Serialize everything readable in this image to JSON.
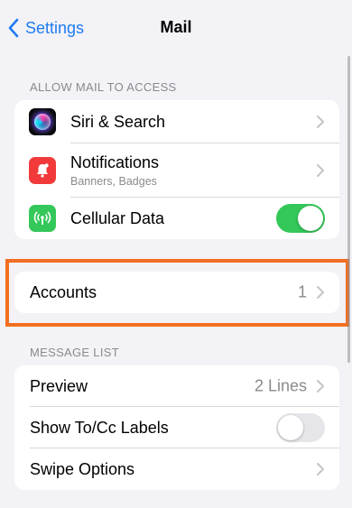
{
  "nav": {
    "back_label": "Settings",
    "title": "Mail"
  },
  "section_access": {
    "header": "ALLOW MAIL TO ACCESS",
    "rows": [
      {
        "label": "Siri & Search",
        "icon": "siri-icon"
      },
      {
        "label": "Notifications",
        "subtitle": "Banners, Badges",
        "icon": "bell-icon"
      },
      {
        "label": "Cellular Data",
        "icon": "antenna-icon",
        "toggle": true
      }
    ]
  },
  "accounts": {
    "label": "Accounts",
    "value": "1"
  },
  "section_message_list": {
    "header": "MESSAGE LIST",
    "rows": [
      {
        "label": "Preview",
        "value": "2 Lines"
      },
      {
        "label": "Show To/Cc Labels",
        "toggle": false
      },
      {
        "label": "Swipe Options"
      }
    ]
  },
  "colors": {
    "accent": "#1f7cf0",
    "highlight": "#f26f21",
    "toggle_on": "#34c759"
  }
}
